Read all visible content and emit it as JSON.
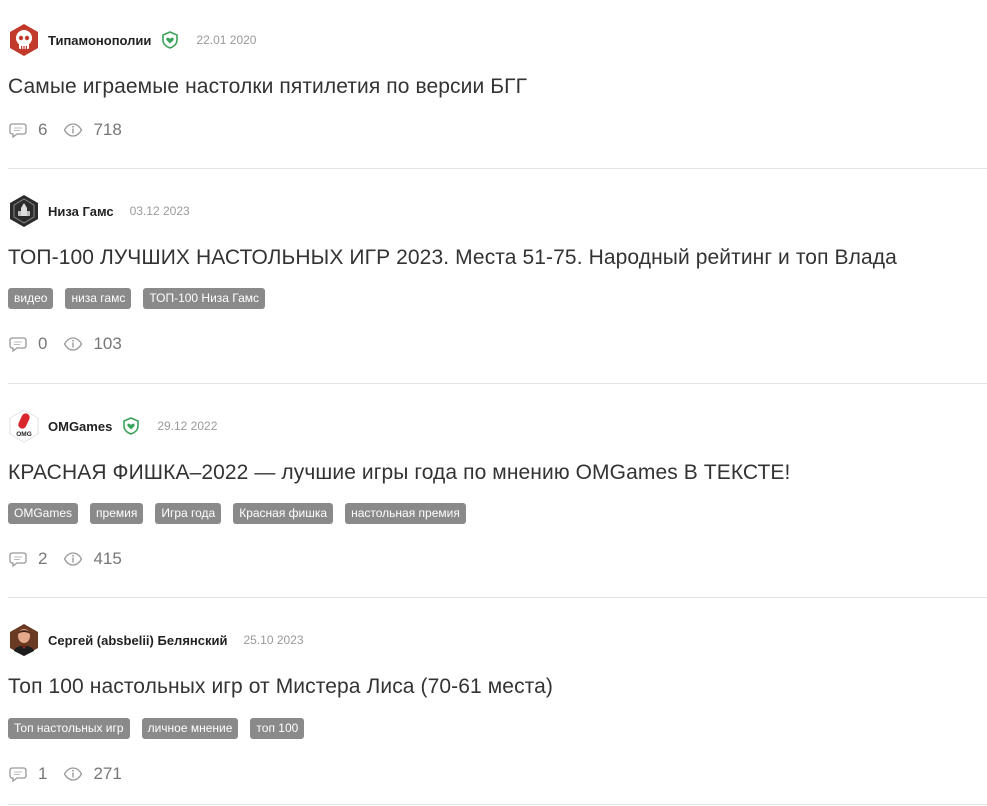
{
  "posts": [
    {
      "author": "Типамонополии",
      "verified": true,
      "date": "22.01 2020",
      "title": "Самые играемые настолки пятилетия по версии БГГ",
      "tags": [],
      "comments": "6",
      "views": "718",
      "avatar_icon": "skull-avatar-icon"
    },
    {
      "author": "Низа Гамс",
      "verified": false,
      "date": "03.12 2023",
      "title": "ТОП-100 ЛУЧШИХ НАСТОЛЬНЫХ ИГР 2023. Места 51-75. Народный рейтинг и топ Влада",
      "tags": [
        "видео",
        "низа гамс",
        "ТОП-100 Низа Гамс"
      ],
      "comments": "0",
      "views": "103",
      "avatar_icon": "castle-avatar-icon"
    },
    {
      "author": "OMGames",
      "verified": true,
      "date": "29.12 2022",
      "title": "КРАСНАЯ ФИШКА–2022 — лучшие игры года по мнению OMGames В ТЕКСТЕ!",
      "tags": [
        "OMGames",
        "премия",
        "Игра года",
        "Красная фишка",
        "настольная премия"
      ],
      "comments": "2",
      "views": "415",
      "avatar_icon": "omg-logo-avatar-icon",
      "avatar_text": "OMG"
    },
    {
      "author": "Сергей (absbelii) Белянский",
      "verified": false,
      "date": "25.10 2023",
      "title": "Топ 100 настольных игр от Мистера Лиса (70-61 места)",
      "tags": [
        "Топ настольных игр",
        "личное мнение",
        "топ 100"
      ],
      "comments": "1",
      "views": "271",
      "avatar_icon": "user-photo-avatar-icon"
    }
  ],
  "colors": {
    "tag_bg": "#8a8a8a",
    "verified_green": "#3aa35a",
    "skull_red": "#c0392b",
    "omg_red": "#d8262c"
  }
}
